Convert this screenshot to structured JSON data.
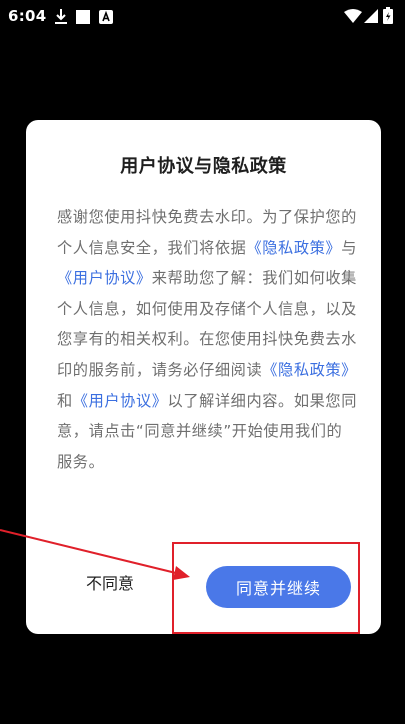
{
  "status_bar": {
    "time": "6:04",
    "icons": [
      "download-icon",
      "square-icon",
      "a-badge-icon",
      "wifi-icon",
      "signal-icon",
      "battery-icon"
    ]
  },
  "dialog": {
    "title": "用户协议与隐私政策",
    "body": [
      {
        "type": "text",
        "text": "感谢您使用抖快免费去水印。为了保护您的个人信息安全，我们将依据"
      },
      {
        "type": "link",
        "text": "《隐私政策》"
      },
      {
        "type": "text",
        "text": "与"
      },
      {
        "type": "link",
        "text": "《用户协议》"
      },
      {
        "type": "text",
        "text": "来帮助您了解：我们如何收集个人信息，如何使用及存储个人信息，以及您享有的相关权利。在您使用抖快免费去水印的服务前，请务必仔细阅读"
      },
      {
        "type": "link",
        "text": "《隐私政策》"
      },
      {
        "type": "text",
        "text": "和"
      },
      {
        "type": "link",
        "text": "《用户协议》"
      },
      {
        "type": "text",
        "text": "以了解详细内容。如果您同意，请点击“同意并继续”开始使用我们的服务。"
      }
    ],
    "disagree_label": "不同意",
    "agree_label": "同意并继续"
  },
  "colors": {
    "background": "#000000",
    "dialog": "#ffffff",
    "link": "#3b6fe0",
    "primary_button": "#4a78e8",
    "annotation": "#e0202a"
  }
}
